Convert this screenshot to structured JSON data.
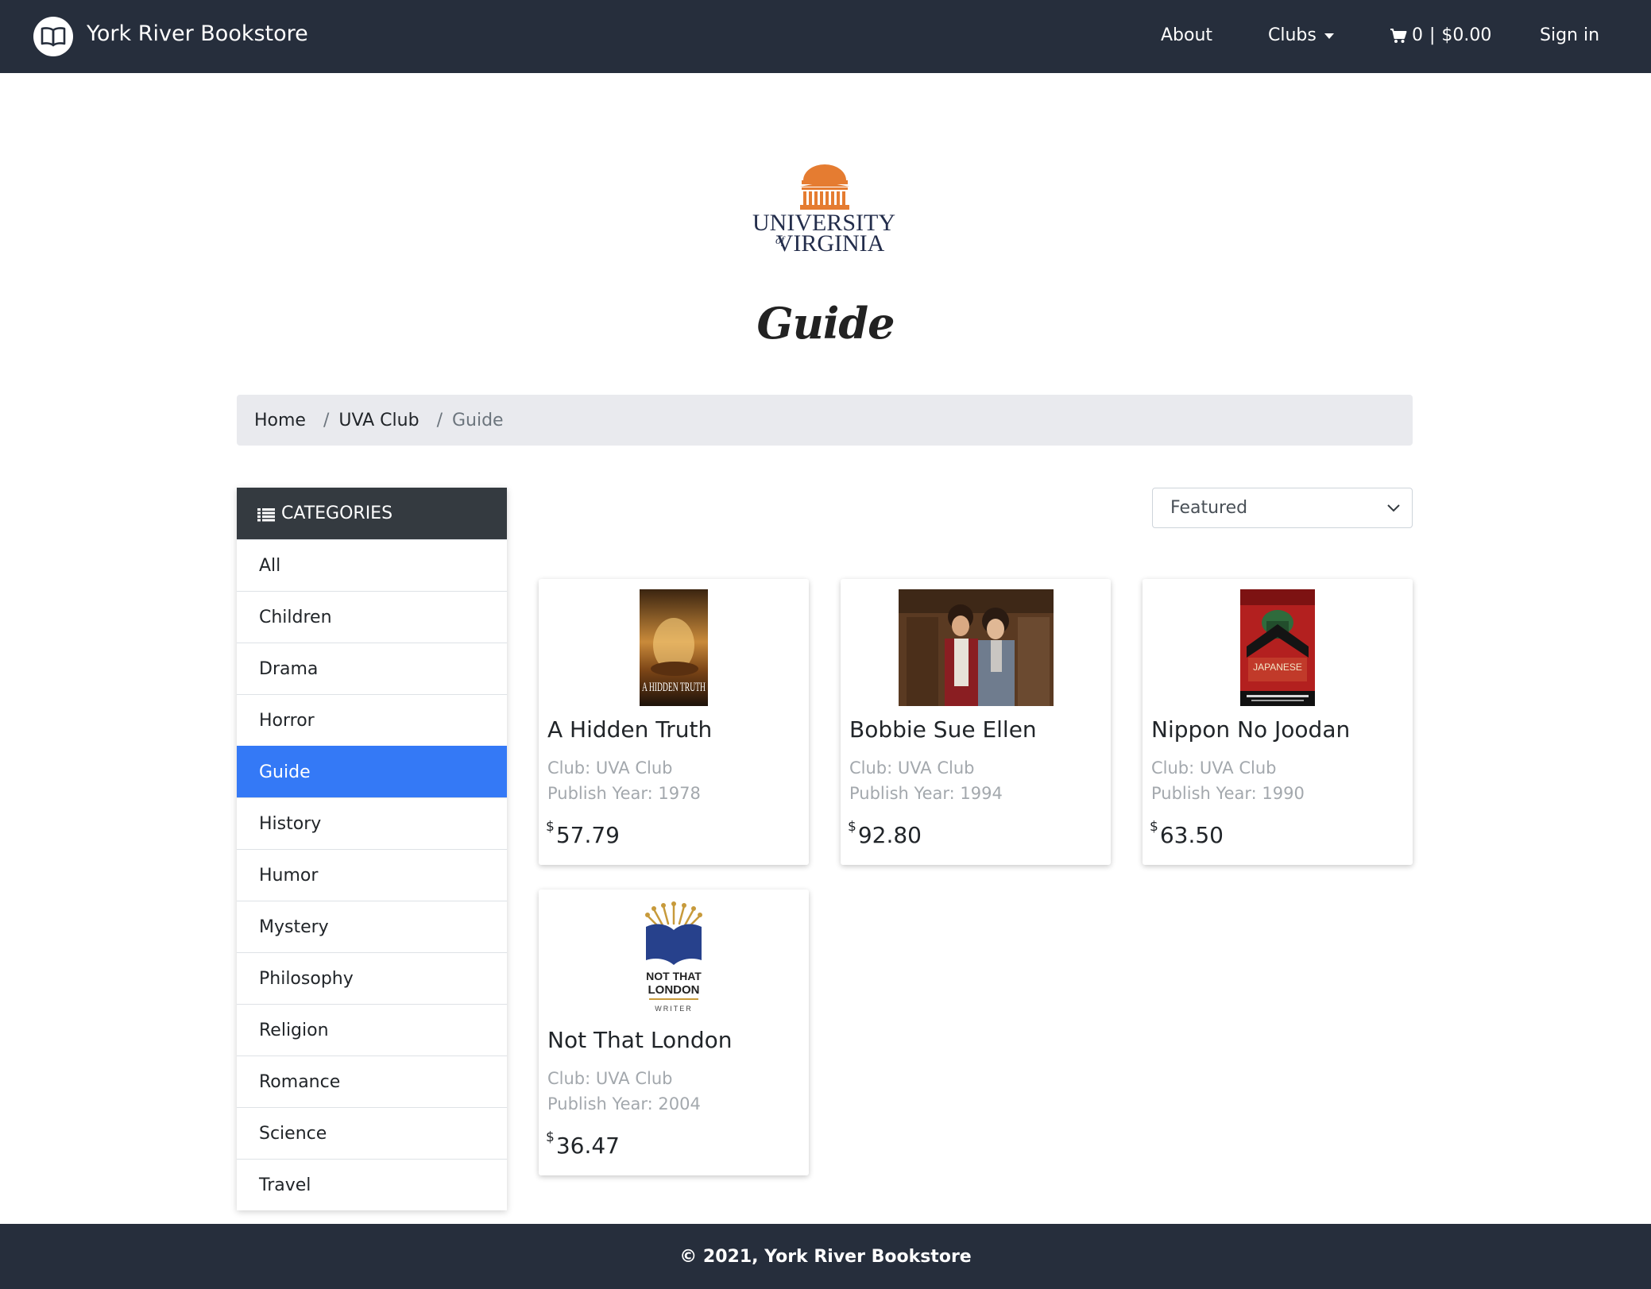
{
  "navbar": {
    "brand": "York River Bookstore",
    "about": "About",
    "clubs": "Clubs",
    "cart_count": "0",
    "cart_total": "$0.00",
    "sign_in": "Sign in"
  },
  "hero": {
    "logo_line1": "UNIVERSITY",
    "logo_of": "of",
    "logo_line2": "VIRGINIA",
    "heading": "Guide"
  },
  "breadcrumb": {
    "home": "Home",
    "club": "UVA Club",
    "current": "Guide",
    "separator": "/"
  },
  "sidebar": {
    "header": "CATEGORIES",
    "items": [
      {
        "label": "All"
      },
      {
        "label": "Children"
      },
      {
        "label": "Drama"
      },
      {
        "label": "Horror"
      },
      {
        "label": "Guide"
      },
      {
        "label": "History"
      },
      {
        "label": "Humor"
      },
      {
        "label": "Mystery"
      },
      {
        "label": "Philosophy"
      },
      {
        "label": "Religion"
      },
      {
        "label": "Romance"
      },
      {
        "label": "Science"
      },
      {
        "label": "Travel"
      }
    ],
    "active": "Guide"
  },
  "sort": {
    "selected": "Featured"
  },
  "products": [
    {
      "title": "A Hidden Truth",
      "club": "Club: UVA Club",
      "year": "Publish Year: 1978",
      "currency": "$",
      "price": "57.79",
      "cover_text": "A HIDDEN TRUTH"
    },
    {
      "title": "Bobbie Sue Ellen",
      "club": "Club: UVA Club",
      "year": "Publish Year: 1994",
      "currency": "$",
      "price": "92.80"
    },
    {
      "title": "Nippon No Joodan",
      "club": "Club: UVA Club",
      "year": "Publish Year: 1990",
      "currency": "$",
      "price": "63.50",
      "cover_text": "JAPANESE"
    },
    {
      "title": "Not That London",
      "club": "Club: UVA Club",
      "year": "Publish Year: 2004",
      "currency": "$",
      "price": "36.47",
      "cover_line1": "NOT THAT",
      "cover_line2": "LONDON",
      "cover_line3": "WRITER"
    }
  ],
  "footer": {
    "text": "© 2021, York River Bookstore"
  },
  "colors": {
    "navbar_bg": "#262e3c",
    "accent": "#3479f6",
    "uva_orange": "#e57c31",
    "uva_navy": "#232d4b"
  }
}
